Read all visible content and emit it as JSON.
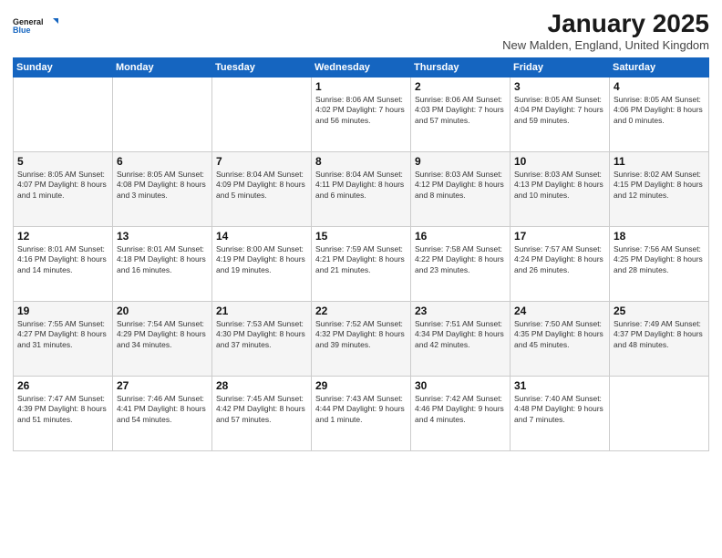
{
  "logo": {
    "line1": "General",
    "line2": "Blue"
  },
  "title": "January 2025",
  "location": "New Malden, England, United Kingdom",
  "days_of_week": [
    "Sunday",
    "Monday",
    "Tuesday",
    "Wednesday",
    "Thursday",
    "Friday",
    "Saturday"
  ],
  "weeks": [
    [
      {
        "num": "",
        "info": ""
      },
      {
        "num": "",
        "info": ""
      },
      {
        "num": "",
        "info": ""
      },
      {
        "num": "1",
        "info": "Sunrise: 8:06 AM\nSunset: 4:02 PM\nDaylight: 7 hours and 56 minutes."
      },
      {
        "num": "2",
        "info": "Sunrise: 8:06 AM\nSunset: 4:03 PM\nDaylight: 7 hours and 57 minutes."
      },
      {
        "num": "3",
        "info": "Sunrise: 8:05 AM\nSunset: 4:04 PM\nDaylight: 7 hours and 59 minutes."
      },
      {
        "num": "4",
        "info": "Sunrise: 8:05 AM\nSunset: 4:06 PM\nDaylight: 8 hours and 0 minutes."
      }
    ],
    [
      {
        "num": "5",
        "info": "Sunrise: 8:05 AM\nSunset: 4:07 PM\nDaylight: 8 hours and 1 minute."
      },
      {
        "num": "6",
        "info": "Sunrise: 8:05 AM\nSunset: 4:08 PM\nDaylight: 8 hours and 3 minutes."
      },
      {
        "num": "7",
        "info": "Sunrise: 8:04 AM\nSunset: 4:09 PM\nDaylight: 8 hours and 5 minutes."
      },
      {
        "num": "8",
        "info": "Sunrise: 8:04 AM\nSunset: 4:11 PM\nDaylight: 8 hours and 6 minutes."
      },
      {
        "num": "9",
        "info": "Sunrise: 8:03 AM\nSunset: 4:12 PM\nDaylight: 8 hours and 8 minutes."
      },
      {
        "num": "10",
        "info": "Sunrise: 8:03 AM\nSunset: 4:13 PM\nDaylight: 8 hours and 10 minutes."
      },
      {
        "num": "11",
        "info": "Sunrise: 8:02 AM\nSunset: 4:15 PM\nDaylight: 8 hours and 12 minutes."
      }
    ],
    [
      {
        "num": "12",
        "info": "Sunrise: 8:01 AM\nSunset: 4:16 PM\nDaylight: 8 hours and 14 minutes."
      },
      {
        "num": "13",
        "info": "Sunrise: 8:01 AM\nSunset: 4:18 PM\nDaylight: 8 hours and 16 minutes."
      },
      {
        "num": "14",
        "info": "Sunrise: 8:00 AM\nSunset: 4:19 PM\nDaylight: 8 hours and 19 minutes."
      },
      {
        "num": "15",
        "info": "Sunrise: 7:59 AM\nSunset: 4:21 PM\nDaylight: 8 hours and 21 minutes."
      },
      {
        "num": "16",
        "info": "Sunrise: 7:58 AM\nSunset: 4:22 PM\nDaylight: 8 hours and 23 minutes."
      },
      {
        "num": "17",
        "info": "Sunrise: 7:57 AM\nSunset: 4:24 PM\nDaylight: 8 hours and 26 minutes."
      },
      {
        "num": "18",
        "info": "Sunrise: 7:56 AM\nSunset: 4:25 PM\nDaylight: 8 hours and 28 minutes."
      }
    ],
    [
      {
        "num": "19",
        "info": "Sunrise: 7:55 AM\nSunset: 4:27 PM\nDaylight: 8 hours and 31 minutes."
      },
      {
        "num": "20",
        "info": "Sunrise: 7:54 AM\nSunset: 4:29 PM\nDaylight: 8 hours and 34 minutes."
      },
      {
        "num": "21",
        "info": "Sunrise: 7:53 AM\nSunset: 4:30 PM\nDaylight: 8 hours and 37 minutes."
      },
      {
        "num": "22",
        "info": "Sunrise: 7:52 AM\nSunset: 4:32 PM\nDaylight: 8 hours and 39 minutes."
      },
      {
        "num": "23",
        "info": "Sunrise: 7:51 AM\nSunset: 4:34 PM\nDaylight: 8 hours and 42 minutes."
      },
      {
        "num": "24",
        "info": "Sunrise: 7:50 AM\nSunset: 4:35 PM\nDaylight: 8 hours and 45 minutes."
      },
      {
        "num": "25",
        "info": "Sunrise: 7:49 AM\nSunset: 4:37 PM\nDaylight: 8 hours and 48 minutes."
      }
    ],
    [
      {
        "num": "26",
        "info": "Sunrise: 7:47 AM\nSunset: 4:39 PM\nDaylight: 8 hours and 51 minutes."
      },
      {
        "num": "27",
        "info": "Sunrise: 7:46 AM\nSunset: 4:41 PM\nDaylight: 8 hours and 54 minutes."
      },
      {
        "num": "28",
        "info": "Sunrise: 7:45 AM\nSunset: 4:42 PM\nDaylight: 8 hours and 57 minutes."
      },
      {
        "num": "29",
        "info": "Sunrise: 7:43 AM\nSunset: 4:44 PM\nDaylight: 9 hours and 1 minute."
      },
      {
        "num": "30",
        "info": "Sunrise: 7:42 AM\nSunset: 4:46 PM\nDaylight: 9 hours and 4 minutes."
      },
      {
        "num": "31",
        "info": "Sunrise: 7:40 AM\nSunset: 4:48 PM\nDaylight: 9 hours and 7 minutes."
      },
      {
        "num": "",
        "info": ""
      }
    ]
  ]
}
